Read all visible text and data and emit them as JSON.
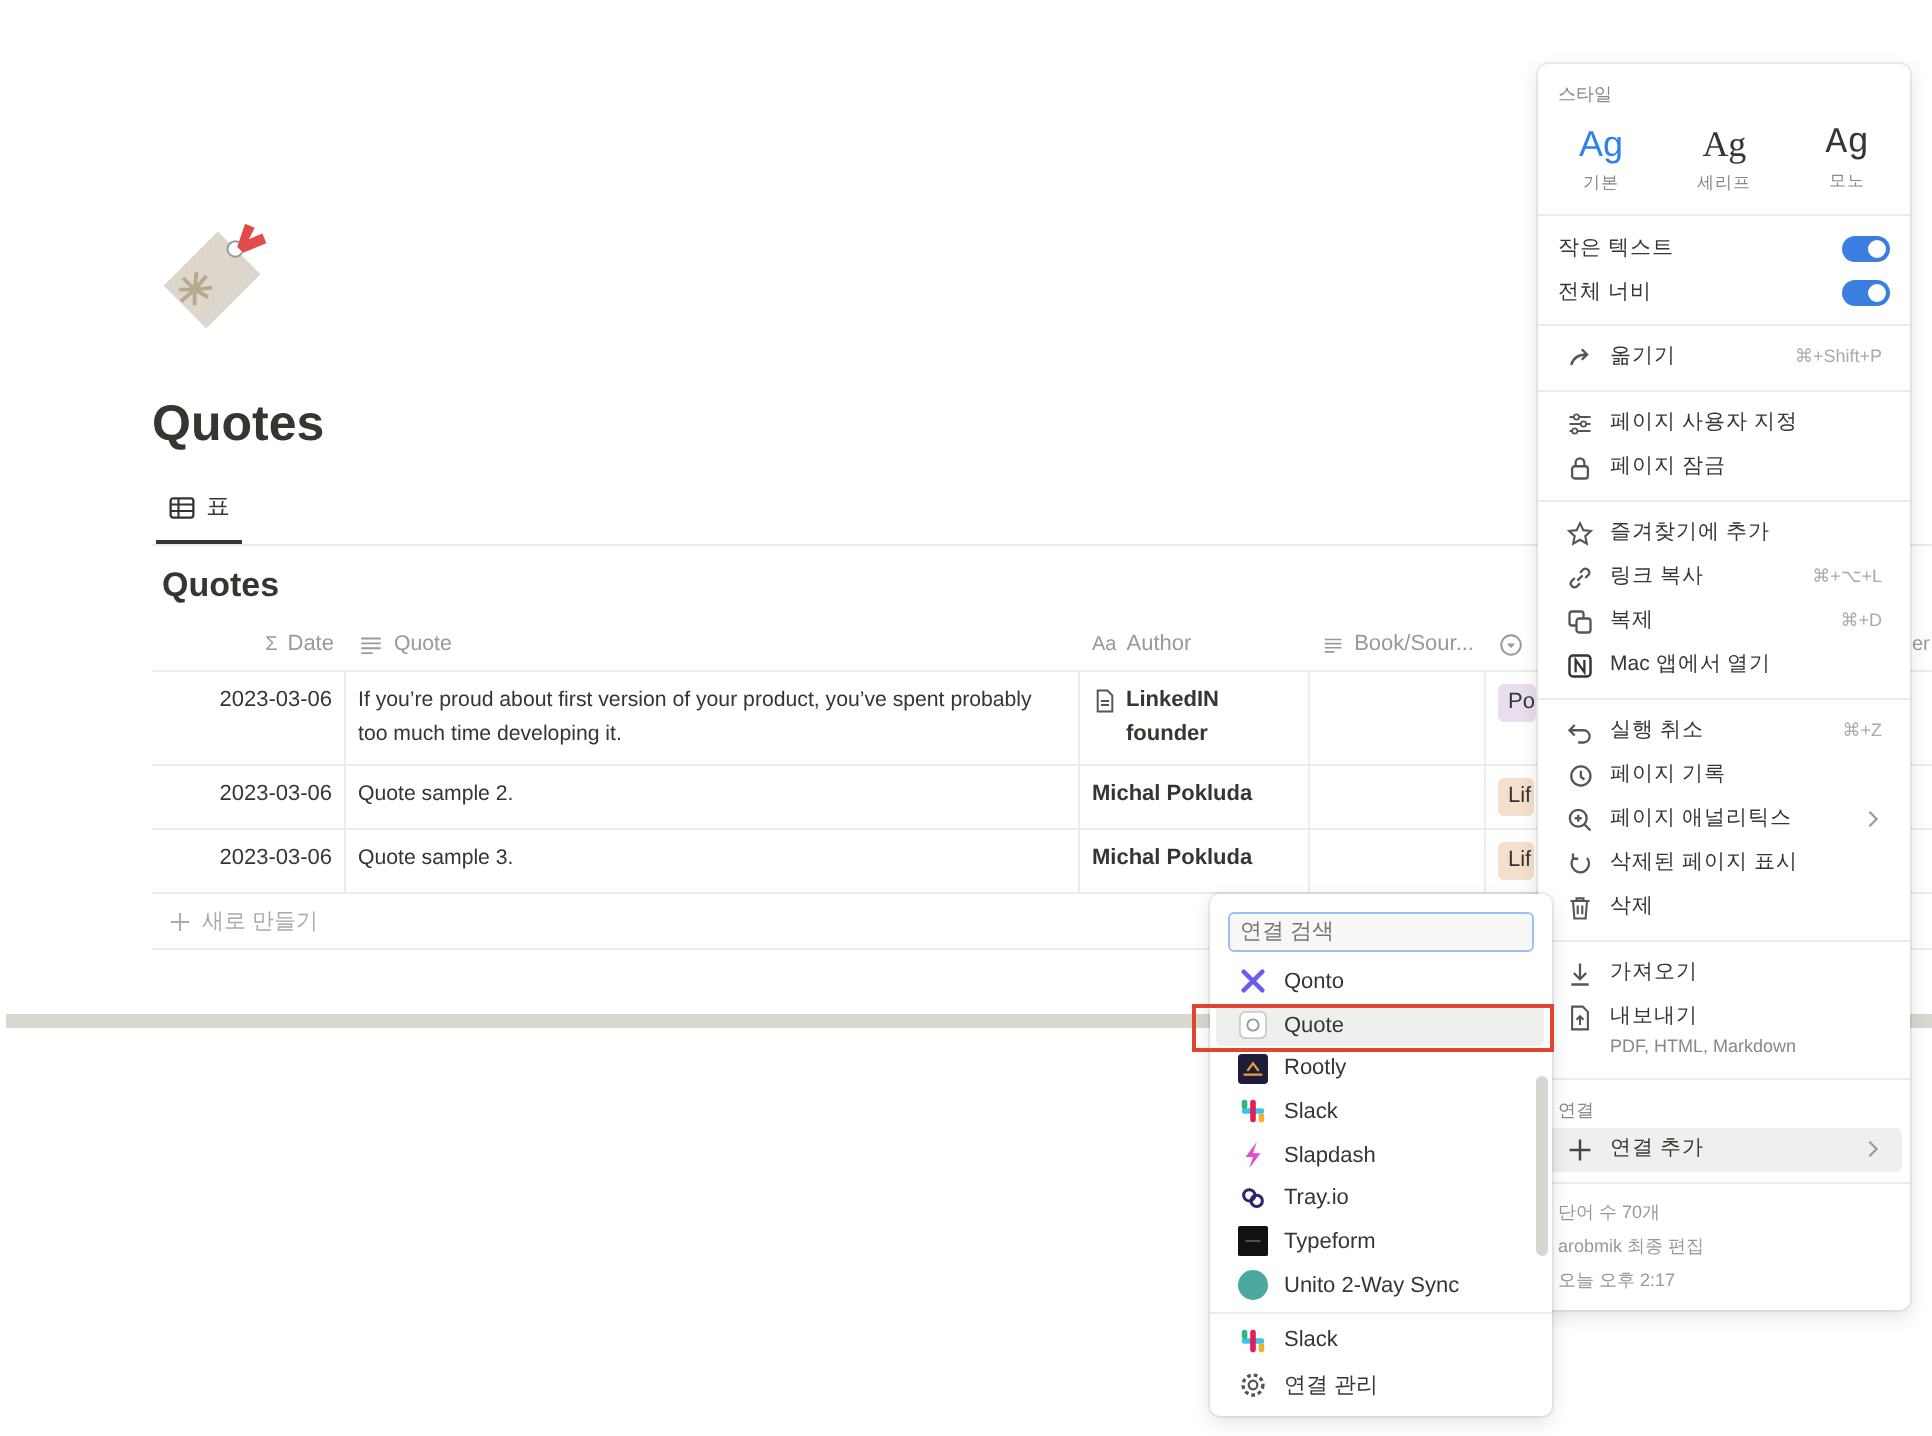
{
  "page": {
    "title": "Quotes",
    "views": [
      {
        "label": "표",
        "selected": true
      }
    ],
    "database_title": "Quotes"
  },
  "table": {
    "columns": [
      {
        "label": "Date",
        "sym": "Σ"
      },
      {
        "label": "Quote"
      },
      {
        "label": "Author",
        "sym": "Aa"
      },
      {
        "label": "Book/Sour..."
      },
      {
        "kind": "select"
      },
      {
        "label": "er"
      }
    ],
    "rows": [
      {
        "date": "2023-03-06",
        "quote": "If you’re proud about first version of your product, you’ve spent probably too much time developing it.",
        "author": "LinkedIN founder",
        "author_page": true,
        "tag": "Po",
        "color": "#e8deee"
      },
      {
        "date": "2023-03-06",
        "quote": "Quote sample 2.",
        "author": "Michal Pokluda",
        "author_page": false,
        "tag": "Lif",
        "color": "#f4dfcc"
      },
      {
        "date": "2023-03-06",
        "quote": "Quote sample 3.",
        "author": "Michal Pokluda",
        "author_page": false,
        "tag": "Lif",
        "color": "#f4dfcc"
      }
    ],
    "new_row": "새로 만들기"
  },
  "menu": {
    "style_label": "스타일",
    "fonts": [
      {
        "sample": "Ag",
        "label": "기본",
        "kind": "sans",
        "selected": true
      },
      {
        "sample": "Ag",
        "label": "세리프",
        "kind": "serif",
        "selected": false
      },
      {
        "sample": "Ag",
        "label": "모노",
        "kind": "mono",
        "selected": false
      }
    ],
    "toggles": [
      {
        "label": "작은 텍스트",
        "on": true
      },
      {
        "label": "전체 너비",
        "on": true
      }
    ],
    "groups": [
      [
        {
          "label": "옮기기",
          "shortcut": "⌘+Shift+P"
        }
      ],
      [
        {
          "label": "페이지 사용자 지정"
        },
        {
          "label": "페이지 잠금"
        }
      ],
      [
        {
          "label": "즐겨찾기에 추가"
        },
        {
          "label": "링크 복사",
          "shortcut": "⌘+⌥+L"
        },
        {
          "label": "복제",
          "shortcut": "⌘+D"
        },
        {
          "label": "Mac 앱에서 열기"
        }
      ],
      [
        {
          "label": "실행 취소",
          "shortcut": "⌘+Z"
        },
        {
          "label": "페이지 기록"
        },
        {
          "label": "페이지 애널리틱스",
          "submenu": true
        },
        {
          "label": "삭제된 페이지 표시"
        },
        {
          "label": "삭제"
        }
      ],
      [
        {
          "label": "가져오기"
        },
        {
          "label": "내보내기",
          "sub": "PDF, HTML, Markdown"
        }
      ]
    ],
    "connections_label": "연결",
    "connection_add": {
      "label": "연결 추가",
      "submenu": true,
      "hovered": true
    },
    "footer": [
      "단어 수 70개",
      "arobmik 최종 편집",
      "오늘 오후 2:17"
    ]
  },
  "popup": {
    "placeholder": "연결 검색",
    "items": [
      {
        "label": "Qonto",
        "selected": false
      },
      {
        "label": "Quote",
        "selected": true
      },
      {
        "label": "Rootly",
        "selected": false
      },
      {
        "label": "Slack",
        "selected": false
      },
      {
        "label": "Slapdash",
        "selected": false
      },
      {
        "label": "Tray.io",
        "selected": false
      },
      {
        "label": "Typeform",
        "selected": false
      },
      {
        "label": "Unito 2-Way Sync",
        "selected": false
      }
    ],
    "footer": [
      "Slack",
      "연결 관리"
    ]
  }
}
